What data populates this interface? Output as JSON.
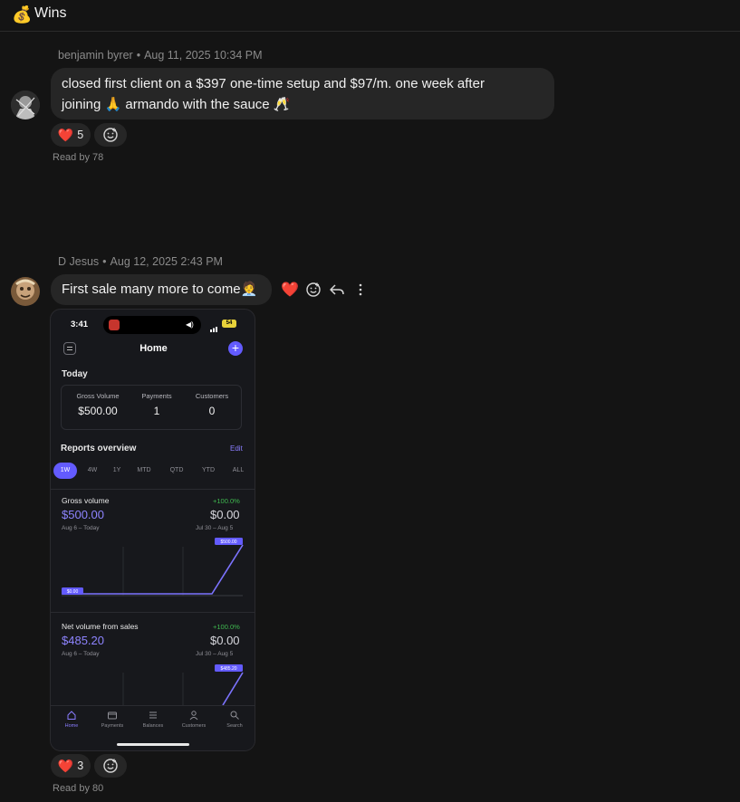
{
  "channel": {
    "icon": "💰",
    "name": "Wins"
  },
  "messages": [
    {
      "author": "benjamin byrer",
      "timestamp": "Aug 11, 2025 10:34 PM",
      "text_line1": "closed first client on a $397 one-time setup and $97/m. one week after",
      "text_line2": "joining 🙏 armando with the sauce 🥂",
      "reaction_emoji": "❤️",
      "reaction_count": "5",
      "read_by": "Read by 78"
    },
    {
      "author": "D Jesus",
      "timestamp": "Aug 12, 2025 2:43 PM",
      "text": "First sale many more to come🧑‍💼",
      "reaction_emoji": "❤️",
      "reaction_count": "3",
      "read_by": "Read by 80",
      "hover_actions": [
        "heart-icon",
        "add-reaction-icon",
        "reply-icon",
        "more-icon"
      ]
    }
  ],
  "phone": {
    "time": "3:41",
    "battery": "54",
    "title": "Home",
    "today_label": "Today",
    "stats": [
      {
        "label": "Gross Volume",
        "value": "$500.00"
      },
      {
        "label": "Payments",
        "value": "1"
      },
      {
        "label": "Customers",
        "value": "0"
      }
    ],
    "reports_title": "Reports overview",
    "edit_label": "Edit",
    "tabs": [
      "1W",
      "4W",
      "1Y",
      "MTD",
      "QTD",
      "YTD",
      "ALL"
    ],
    "charts": [
      {
        "title": "Gross volume",
        "change": "+100.0%",
        "current": "$500.00",
        "previous": "$0.00",
        "current_range": "Aug 6 – Today",
        "previous_range": "Jul 30 – Aug 5",
        "start_label": "$0.00",
        "end_label": "$500.00"
      },
      {
        "title": "Net volume from sales",
        "change": "+100.0%",
        "current": "$485.20",
        "previous": "$0.00",
        "current_range": "Aug 6 – Today",
        "previous_range": "Jul 30 – Aug 5",
        "end_label": "$485.20"
      }
    ],
    "nav": [
      "Home",
      "Payments",
      "Balances",
      "Customers",
      "Search"
    ]
  },
  "colors": {
    "accent": "#635bff",
    "positive": "#3fb950",
    "heart": "#e5383b"
  }
}
